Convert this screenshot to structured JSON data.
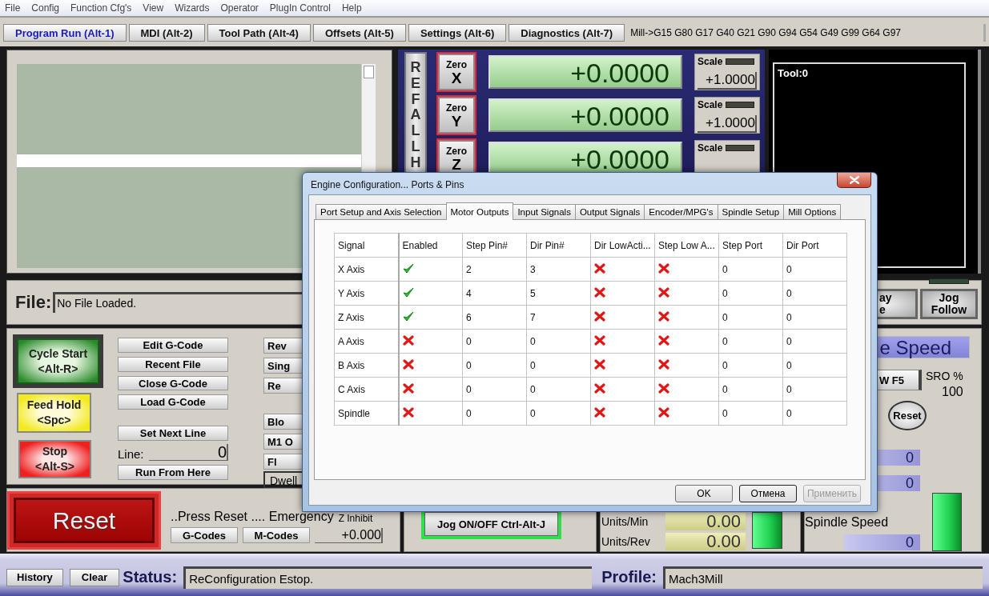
{
  "menu": [
    "File",
    "Config",
    "Function Cfg's",
    "View",
    "Wizards",
    "Operator",
    "PlugIn Control",
    "Help"
  ],
  "tabs": [
    {
      "label": "Program Run (Alt-1)",
      "selected": true
    },
    {
      "label": "MDI (Alt-2)",
      "selected": false
    },
    {
      "label": "Tool Path (Alt-4)",
      "selected": false
    },
    {
      "label": "Offsets (Alt-5)",
      "selected": false
    },
    {
      "label": "Settings (Alt-6)",
      "selected": false
    },
    {
      "label": "Diagnostics (Alt-7)",
      "selected": false
    }
  ],
  "modal_status": "Mill->G15  G80 G17 G40 G21 G90 G94 G54 G49 G99 G64 G97",
  "dro": {
    "ref_all_home": "REFALLH",
    "axes": [
      {
        "zero": "Zero",
        "axis": "X",
        "value": "+0.0000",
        "scale_label": "Scale",
        "scale_led": false,
        "scale": "+1.0000"
      },
      {
        "zero": "Zero",
        "axis": "Y",
        "value": "+0.0000",
        "scale_label": "Scale",
        "scale_led": false,
        "scale": "+1.0000"
      },
      {
        "zero": "Zero",
        "axis": "Z",
        "value": "+0.0000",
        "scale_label": "Scale",
        "scale_led": false
      }
    ]
  },
  "tool_display": "Tool:0",
  "file": {
    "label": "File:",
    "value": "No File Loaded."
  },
  "view_buttons": [
    {
      "lines": [
        "ay",
        "e"
      ]
    },
    {
      "lines": [
        "Jog",
        "Follow"
      ],
      "led_on": false
    }
  ],
  "program": {
    "cycle_start": [
      "Cycle Start",
      "<Alt-R>"
    ],
    "feed_hold": [
      "Feed Hold",
      "<Spc>"
    ],
    "stop": [
      "Stop",
      "<Alt-S>"
    ],
    "file_buttons": [
      "Edit G-Code",
      "Recent File",
      "Close G-Code",
      "Load G-Code"
    ],
    "set_next_line": "Set Next Line",
    "line_label": "Line:",
    "line_value": "0",
    "run_from_here": "Run From Here",
    "option_groups": [
      {
        "items": [
          {
            "kind": "button",
            "label": "Rev"
          },
          {
            "kind": "button",
            "label": "Sing"
          },
          {
            "kind": "button",
            "label": "Re"
          }
        ]
      },
      {
        "items": [
          {
            "kind": "button",
            "label": "Blo"
          },
          {
            "kind": "button",
            "label": "M1 O"
          },
          {
            "kind": "button",
            "label": "Fl"
          },
          {
            "kind": "field",
            "label": "Dwell"
          }
        ]
      }
    ]
  },
  "reset": {
    "label": "Reset",
    "message": "..Press Reset .... Emergency",
    "buttons": [
      "G-Codes",
      "M-Codes"
    ],
    "z_inhibit_label": "Z Inhibit",
    "z_inhibit_value": "+0.000"
  },
  "jog": {
    "label": "Jog ON/OFF Ctrl-Alt-J",
    "on": true
  },
  "feed": {
    "rows": [
      {
        "label": "Units/Min",
        "value": "0.00"
      },
      {
        "label": "Units/Rev",
        "value": "0.00"
      }
    ],
    "led_on": true
  },
  "spindle": {
    "title": "e Speed",
    "button": "W F5",
    "sro_label": "SRO %",
    "sro_value": "100",
    "reset": "Reset",
    "readouts": [
      "0",
      "0"
    ],
    "led_on": true,
    "speed_label": "Spindle Speed",
    "speed_value": "0"
  },
  "status_bar": {
    "history": "History",
    "clear": "Clear",
    "status_label": "Status:",
    "status": "ReConfiguration Estop.",
    "profile_label": "Profile:",
    "profile": "Mach3Mill"
  },
  "dialog": {
    "title": "Engine Configuration... Ports & Pins",
    "tabs": [
      {
        "label": "Port Setup and Axis Selection",
        "selected": false
      },
      {
        "label": "Motor Outputs",
        "selected": true
      },
      {
        "label": "Input Signals",
        "selected": false
      },
      {
        "label": "Output Signals",
        "selected": false
      },
      {
        "label": "Encoder/MPG's",
        "selected": false
      },
      {
        "label": "Spindle Setup",
        "selected": false
      },
      {
        "label": "Mill Options",
        "selected": false
      }
    ],
    "table": {
      "columns": [
        "Signal",
        "Enabled",
        "Step Pin#",
        "Dir Pin#",
        "Dir LowActi...",
        "Step Low A...",
        "Step Port",
        "Dir Port"
      ],
      "rows": [
        {
          "signal": "X Axis",
          "enabled": true,
          "step_pin": "2",
          "dir_pin": "3",
          "dir_low_active": false,
          "step_low_active": false,
          "step_port": "0",
          "dir_port": "0"
        },
        {
          "signal": "Y Axis",
          "enabled": true,
          "step_pin": "4",
          "dir_pin": "5",
          "dir_low_active": false,
          "step_low_active": false,
          "step_port": "0",
          "dir_port": "0"
        },
        {
          "signal": "Z Axis",
          "enabled": true,
          "step_pin": "6",
          "dir_pin": "7",
          "dir_low_active": false,
          "step_low_active": false,
          "step_port": "0",
          "dir_port": "0"
        },
        {
          "signal": "A Axis",
          "enabled": false,
          "step_pin": "0",
          "dir_pin": "0",
          "dir_low_active": false,
          "step_low_active": false,
          "step_port": "0",
          "dir_port": "0"
        },
        {
          "signal": "B Axis",
          "enabled": false,
          "step_pin": "0",
          "dir_pin": "0",
          "dir_low_active": false,
          "step_low_active": false,
          "step_port": "0",
          "dir_port": "0"
        },
        {
          "signal": "C Axis",
          "enabled": false,
          "step_pin": "0",
          "dir_pin": "0",
          "dir_low_active": false,
          "step_low_active": false,
          "step_port": "0",
          "dir_port": "0"
        },
        {
          "signal": "Spindle",
          "enabled": false,
          "step_pin": "0",
          "dir_pin": "0",
          "dir_low_active": false,
          "step_low_active": false,
          "step_port": "0",
          "dir_port": "0"
        }
      ]
    },
    "buttons": [
      {
        "label": "OK",
        "default": false,
        "disabled": false
      },
      {
        "label": "Отмена",
        "default": true,
        "disabled": false
      },
      {
        "label": "Применить",
        "default": false,
        "disabled": true
      }
    ]
  }
}
